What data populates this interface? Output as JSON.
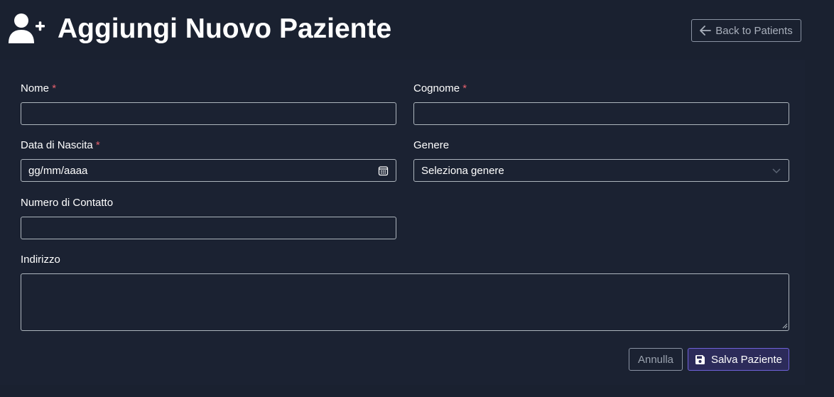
{
  "header": {
    "title": "Aggiungi Nuovo Paziente",
    "title_icon": "user-plus-icon",
    "back_label": "Back to Patients",
    "back_icon": "arrow-left-icon"
  },
  "form": {
    "required_marker": "*",
    "nome": {
      "label": "Nome",
      "value": ""
    },
    "cognome": {
      "label": "Cognome",
      "value": ""
    },
    "data_nascita": {
      "label": "Data di Nascita",
      "placeholder": "gg/mm/aaaa",
      "icon": "calendar-icon"
    },
    "genere": {
      "label": "Genere",
      "selected": "Seleziona genere",
      "icon": "chevron-down-icon"
    },
    "contatto": {
      "label": "Numero di Contatto",
      "value": ""
    },
    "indirizzo": {
      "label": "Indirizzo",
      "value": ""
    }
  },
  "actions": {
    "cancel_label": "Annulla",
    "save_label": "Salva Paziente",
    "save_icon": "floppy-disk-icon"
  },
  "colors": {
    "background": "#1a2130",
    "required": "#e4606d",
    "primary_button": "#2c2b5a",
    "primary_border": "#6f62d9"
  }
}
